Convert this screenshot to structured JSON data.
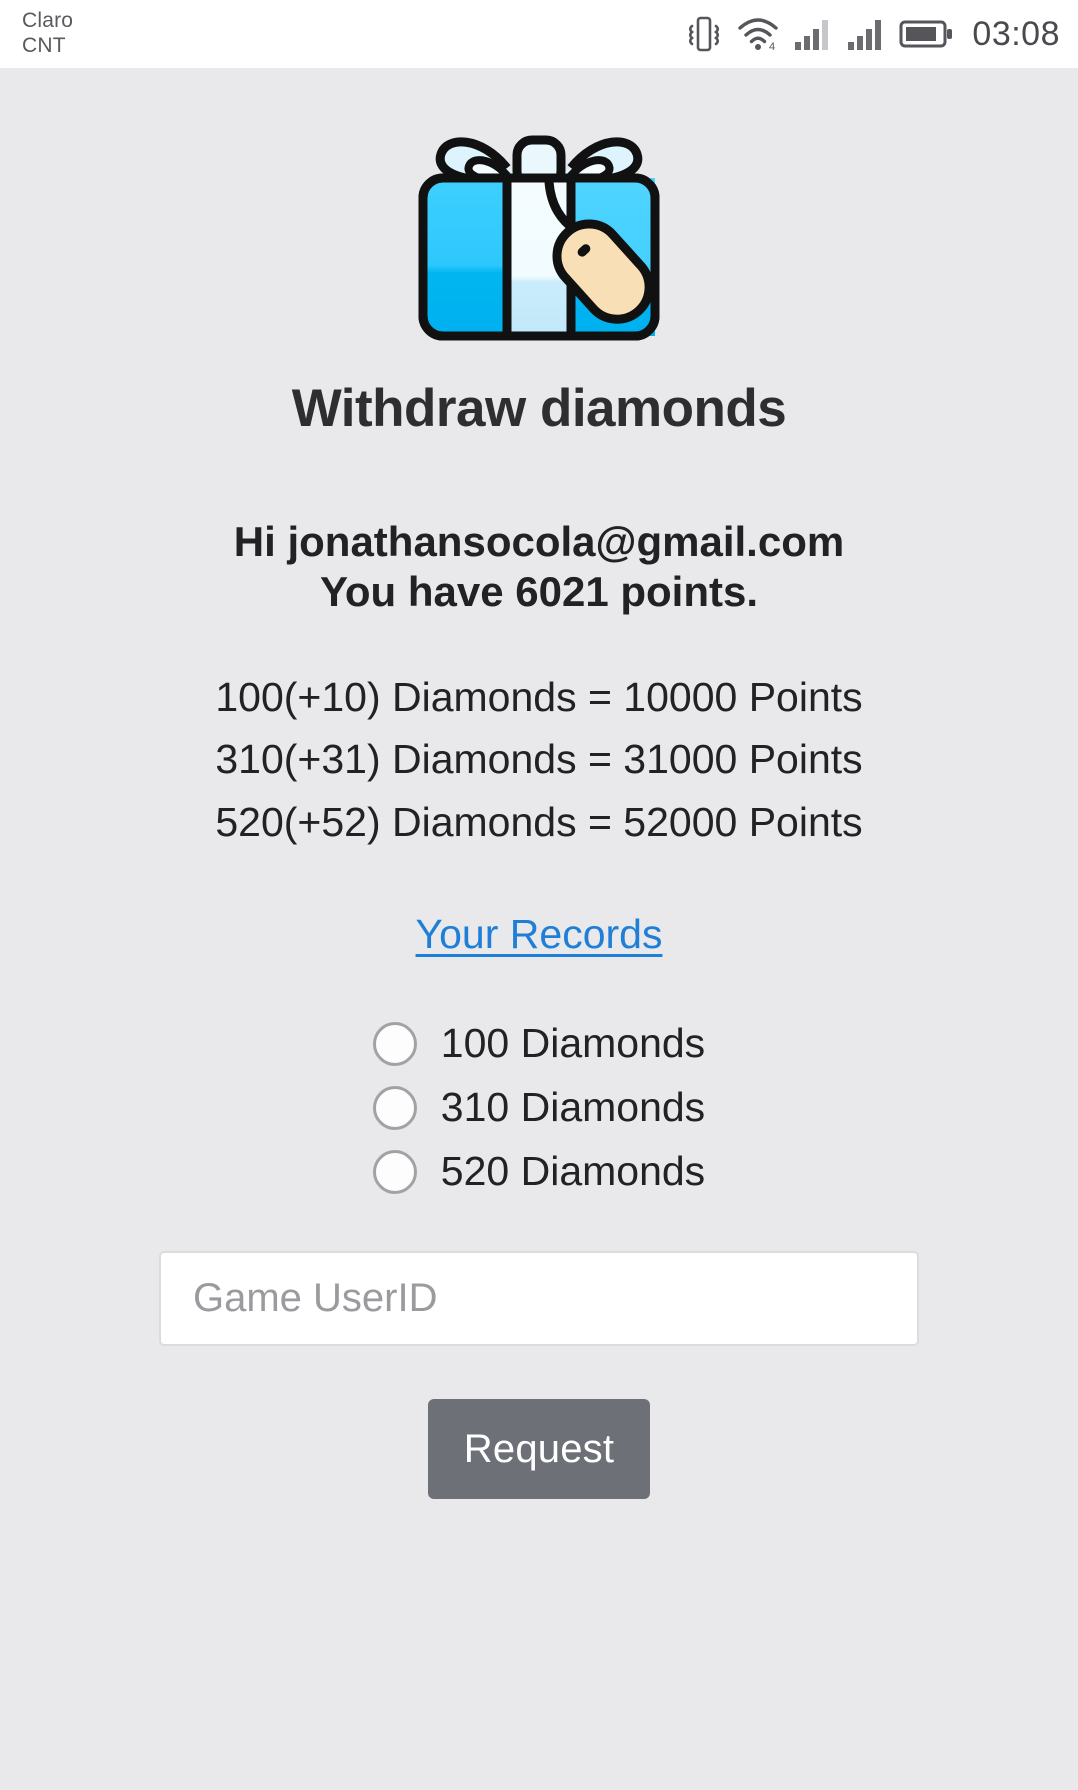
{
  "status_bar": {
    "carrier_primary": "Claro",
    "carrier_secondary": "CNT",
    "time": "03:08",
    "icons": [
      "vibrate-icon",
      "wifi-icon",
      "signal-bars-icon",
      "signal-bars-icon",
      "battery-icon"
    ]
  },
  "header": {
    "icon": "gift-box-icon",
    "title": "Withdraw diamonds"
  },
  "account": {
    "greeting_line": "Hi jonathansocola@gmail.com",
    "points_line": "You have 6021 points."
  },
  "rates": [
    "100(+10) Diamonds = 10000 Points",
    "310(+31) Diamonds = 31000 Points",
    "520(+52) Diamonds = 52000 Points"
  ],
  "records_link": {
    "label": "Your Records"
  },
  "options": [
    {
      "label": "100 Diamonds",
      "selected": false
    },
    {
      "label": "310 Diamonds",
      "selected": false
    },
    {
      "label": "520 Diamonds",
      "selected": false
    }
  ],
  "form": {
    "userid_placeholder": "Game UserID",
    "userid_value": "",
    "submit_label": "Request"
  },
  "colors": {
    "background": "#e9e8ea",
    "link": "#1f7fd8",
    "button": "#6d7077",
    "gift_blue": "#00bcf5",
    "gift_light": "#eaf8fe",
    "tag_tan": "#f8ddb5"
  }
}
